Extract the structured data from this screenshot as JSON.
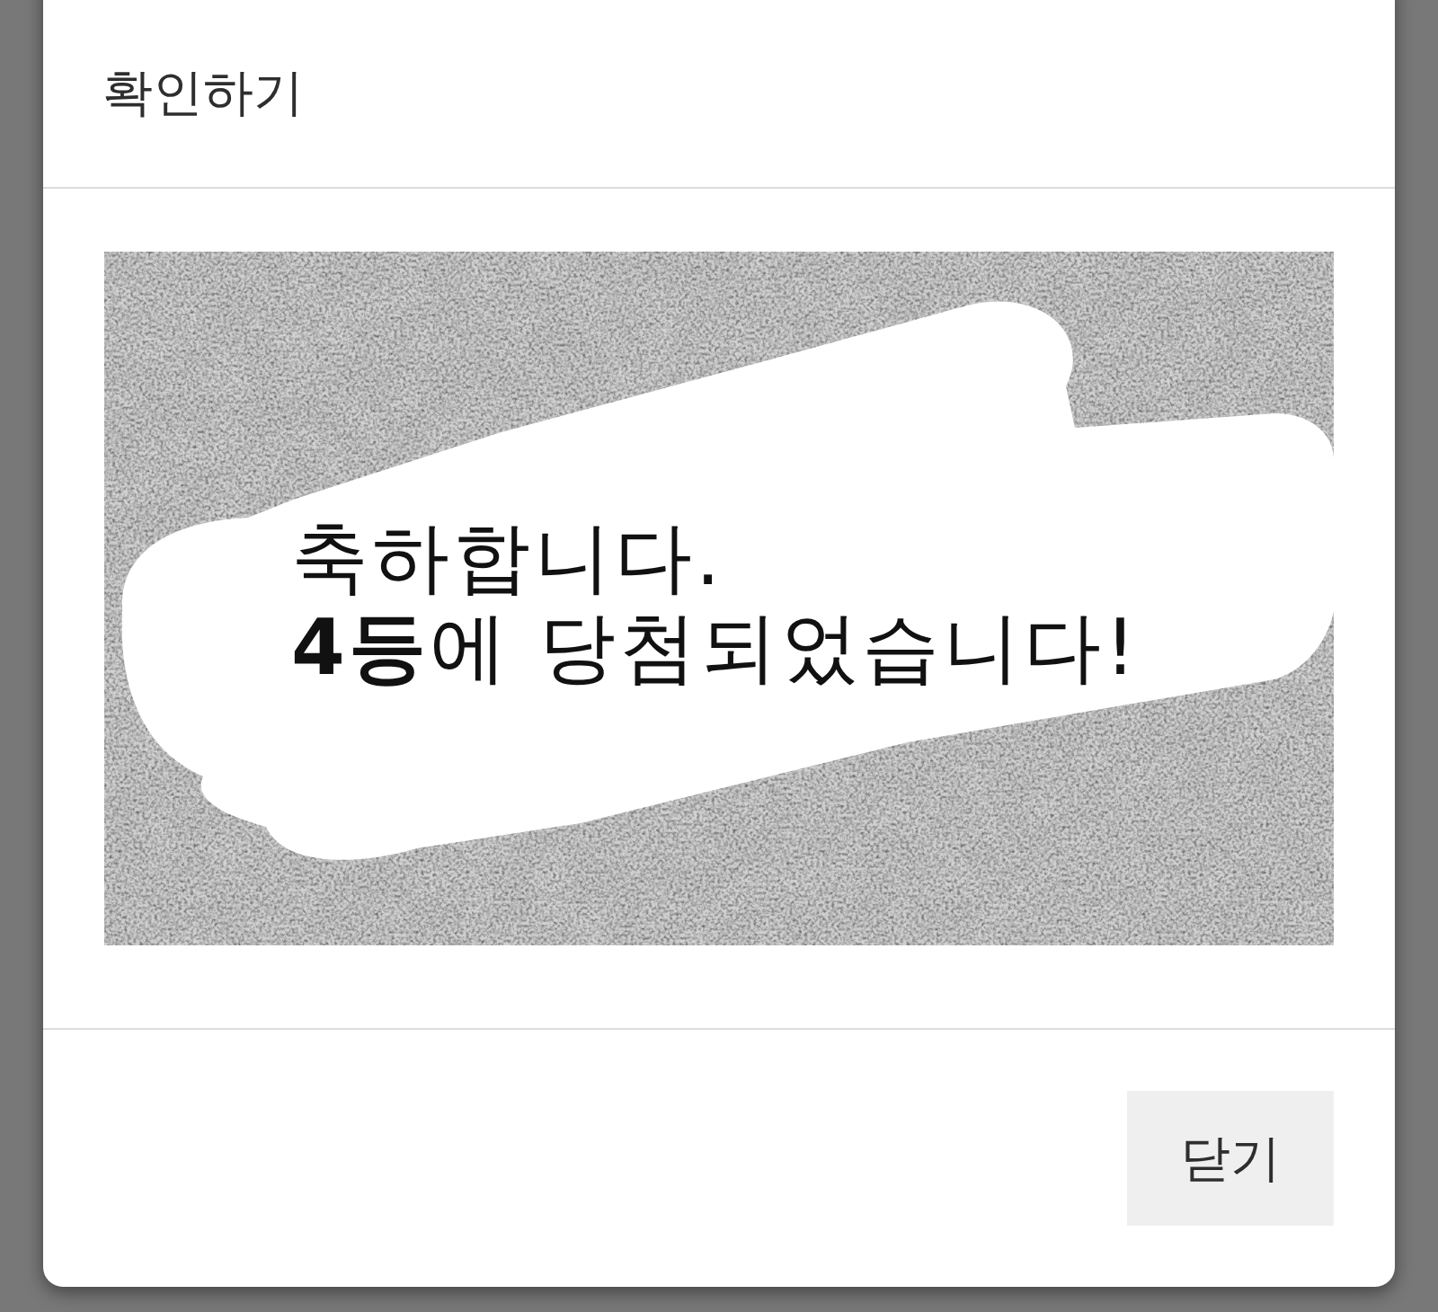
{
  "dialog": {
    "title": "확인하기"
  },
  "scratch_card": {
    "message": [
      "축하합니다.",
      "**4등**에 당첨되었습니다!"
    ]
  },
  "buttons": [
    {
      "label": "닫기",
      "kind": "close"
    }
  ]
}
